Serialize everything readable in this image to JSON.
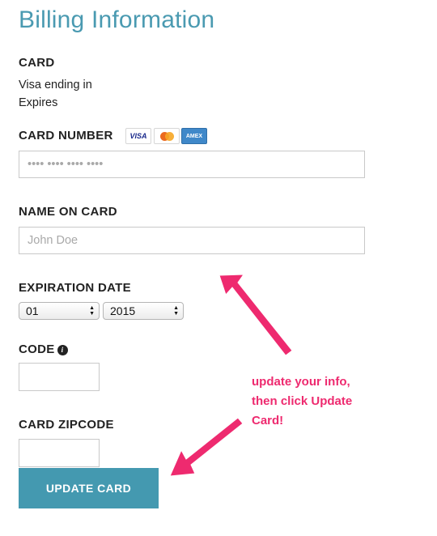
{
  "title": "Billing Information",
  "card": {
    "label": "CARD",
    "line1": "Visa ending in",
    "line2": "Expires"
  },
  "card_number": {
    "label": "CARD NUMBER",
    "placeholder": "•••• •••• •••• ••••",
    "logos": [
      "VISA",
      "mastercard",
      "AMEX"
    ]
  },
  "name_on_card": {
    "label": "NAME ON CARD",
    "placeholder": "John Doe"
  },
  "expiration": {
    "label": "EXPIRATION DATE",
    "month": "01",
    "year": "2015"
  },
  "code": {
    "label": "CODE",
    "icon": "info-icon",
    "icon_glyph": "i"
  },
  "zipcode": {
    "label": "CARD ZIPCODE"
  },
  "button": {
    "label": "UPDATE CARD"
  },
  "annotation": {
    "line1": "update your info,",
    "line2": "then click Update",
    "line3": "Card!",
    "color": "#ee2a6f"
  },
  "colors": {
    "title": "#4a9ab1",
    "button": "#4499b0",
    "arrow": "#ee2a6f"
  }
}
